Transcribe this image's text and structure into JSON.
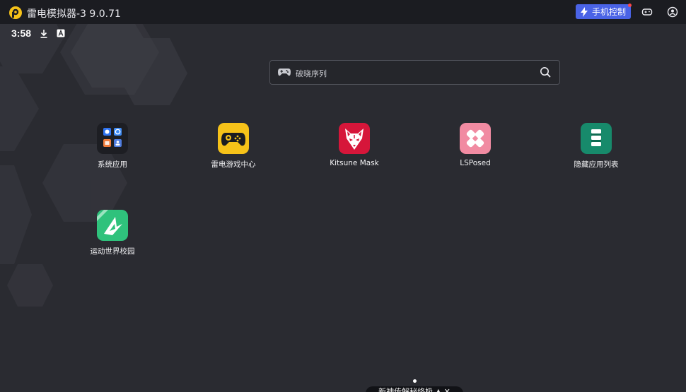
{
  "titlebar": {
    "title": "雷电模拟器-3 9.0.71",
    "phone_control_label": "手机控制"
  },
  "status_bar": {
    "time": "3:58"
  },
  "search": {
    "placeholder": "破晓序列"
  },
  "apps": [
    {
      "label": "系统应用",
      "icon": "system-apps-folder-icon"
    },
    {
      "label": "雷电游戏中心",
      "icon": "game-center-icon"
    },
    {
      "label": "Kitsune Mask",
      "icon": "kitsune-mask-icon"
    },
    {
      "label": "LSPosed",
      "icon": "lsposed-icon"
    },
    {
      "label": "隐藏应用列表",
      "icon": "hide-app-list-icon"
    },
    {
      "label": "运动世界校园",
      "icon": "sport-world-campus-icon"
    }
  ],
  "toast": {
    "text": "新神传解秘终极 ▲ ✕"
  },
  "colors": {
    "titlebar_bg": "#1b1c21",
    "screen_bg": "#2a2b31",
    "accent": "#4a63e6",
    "game_center": "#f6c219",
    "kitsune": "#d6163a",
    "lsposed": "#f18ba2",
    "hide_list": "#178a6b",
    "sport_world": "#2fc27c"
  }
}
